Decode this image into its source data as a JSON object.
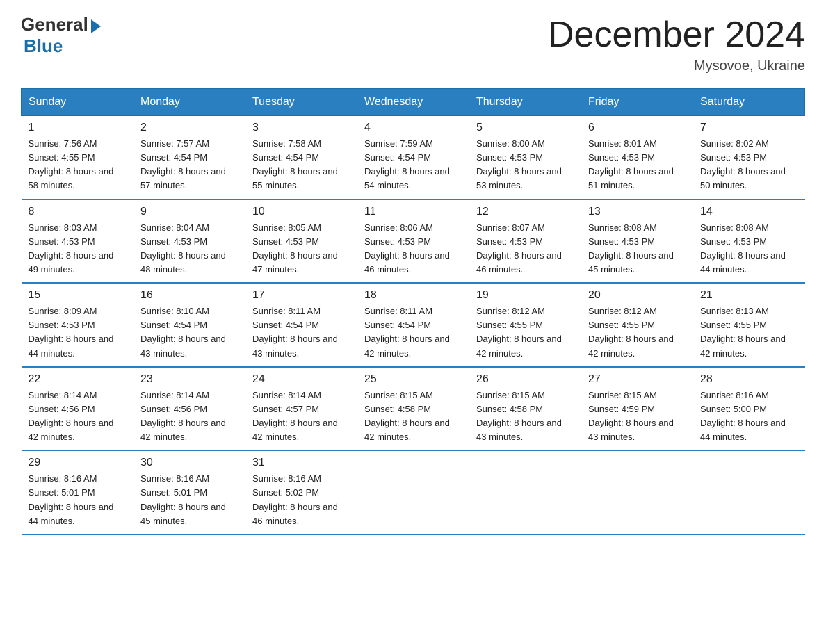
{
  "header": {
    "logo_general": "General",
    "logo_blue": "Blue",
    "month_title": "December 2024",
    "location": "Mysovoe, Ukraine"
  },
  "days_of_week": [
    "Sunday",
    "Monday",
    "Tuesday",
    "Wednesday",
    "Thursday",
    "Friday",
    "Saturday"
  ],
  "weeks": [
    [
      {
        "num": "1",
        "sunrise": "7:56 AM",
        "sunset": "4:55 PM",
        "daylight": "8 hours and 58 minutes."
      },
      {
        "num": "2",
        "sunrise": "7:57 AM",
        "sunset": "4:54 PM",
        "daylight": "8 hours and 57 minutes."
      },
      {
        "num": "3",
        "sunrise": "7:58 AM",
        "sunset": "4:54 PM",
        "daylight": "8 hours and 55 minutes."
      },
      {
        "num": "4",
        "sunrise": "7:59 AM",
        "sunset": "4:54 PM",
        "daylight": "8 hours and 54 minutes."
      },
      {
        "num": "5",
        "sunrise": "8:00 AM",
        "sunset": "4:53 PM",
        "daylight": "8 hours and 53 minutes."
      },
      {
        "num": "6",
        "sunrise": "8:01 AM",
        "sunset": "4:53 PM",
        "daylight": "8 hours and 51 minutes."
      },
      {
        "num": "7",
        "sunrise": "8:02 AM",
        "sunset": "4:53 PM",
        "daylight": "8 hours and 50 minutes."
      }
    ],
    [
      {
        "num": "8",
        "sunrise": "8:03 AM",
        "sunset": "4:53 PM",
        "daylight": "8 hours and 49 minutes."
      },
      {
        "num": "9",
        "sunrise": "8:04 AM",
        "sunset": "4:53 PM",
        "daylight": "8 hours and 48 minutes."
      },
      {
        "num": "10",
        "sunrise": "8:05 AM",
        "sunset": "4:53 PM",
        "daylight": "8 hours and 47 minutes."
      },
      {
        "num": "11",
        "sunrise": "8:06 AM",
        "sunset": "4:53 PM",
        "daylight": "8 hours and 46 minutes."
      },
      {
        "num": "12",
        "sunrise": "8:07 AM",
        "sunset": "4:53 PM",
        "daylight": "8 hours and 46 minutes."
      },
      {
        "num": "13",
        "sunrise": "8:08 AM",
        "sunset": "4:53 PM",
        "daylight": "8 hours and 45 minutes."
      },
      {
        "num": "14",
        "sunrise": "8:08 AM",
        "sunset": "4:53 PM",
        "daylight": "8 hours and 44 minutes."
      }
    ],
    [
      {
        "num": "15",
        "sunrise": "8:09 AM",
        "sunset": "4:53 PM",
        "daylight": "8 hours and 44 minutes."
      },
      {
        "num": "16",
        "sunrise": "8:10 AM",
        "sunset": "4:54 PM",
        "daylight": "8 hours and 43 minutes."
      },
      {
        "num": "17",
        "sunrise": "8:11 AM",
        "sunset": "4:54 PM",
        "daylight": "8 hours and 43 minutes."
      },
      {
        "num": "18",
        "sunrise": "8:11 AM",
        "sunset": "4:54 PM",
        "daylight": "8 hours and 42 minutes."
      },
      {
        "num": "19",
        "sunrise": "8:12 AM",
        "sunset": "4:55 PM",
        "daylight": "8 hours and 42 minutes."
      },
      {
        "num": "20",
        "sunrise": "8:12 AM",
        "sunset": "4:55 PM",
        "daylight": "8 hours and 42 minutes."
      },
      {
        "num": "21",
        "sunrise": "8:13 AM",
        "sunset": "4:55 PM",
        "daylight": "8 hours and 42 minutes."
      }
    ],
    [
      {
        "num": "22",
        "sunrise": "8:14 AM",
        "sunset": "4:56 PM",
        "daylight": "8 hours and 42 minutes."
      },
      {
        "num": "23",
        "sunrise": "8:14 AM",
        "sunset": "4:56 PM",
        "daylight": "8 hours and 42 minutes."
      },
      {
        "num": "24",
        "sunrise": "8:14 AM",
        "sunset": "4:57 PM",
        "daylight": "8 hours and 42 minutes."
      },
      {
        "num": "25",
        "sunrise": "8:15 AM",
        "sunset": "4:58 PM",
        "daylight": "8 hours and 42 minutes."
      },
      {
        "num": "26",
        "sunrise": "8:15 AM",
        "sunset": "4:58 PM",
        "daylight": "8 hours and 43 minutes."
      },
      {
        "num": "27",
        "sunrise": "8:15 AM",
        "sunset": "4:59 PM",
        "daylight": "8 hours and 43 minutes."
      },
      {
        "num": "28",
        "sunrise": "8:16 AM",
        "sunset": "5:00 PM",
        "daylight": "8 hours and 44 minutes."
      }
    ],
    [
      {
        "num": "29",
        "sunrise": "8:16 AM",
        "sunset": "5:01 PM",
        "daylight": "8 hours and 44 minutes."
      },
      {
        "num": "30",
        "sunrise": "8:16 AM",
        "sunset": "5:01 PM",
        "daylight": "8 hours and 45 minutes."
      },
      {
        "num": "31",
        "sunrise": "8:16 AM",
        "sunset": "5:02 PM",
        "daylight": "8 hours and 46 minutes."
      },
      null,
      null,
      null,
      null
    ]
  ]
}
